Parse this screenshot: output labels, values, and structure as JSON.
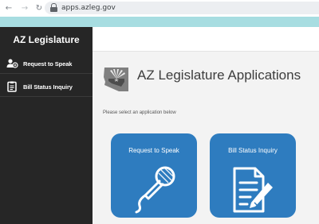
{
  "browser": {
    "back_icon": "arrow-left-icon",
    "forward_icon": "arrow-right-icon",
    "reload_icon": "reload-icon",
    "url": "apps.azleg.gov"
  },
  "sidebar": {
    "brand": "AZ Legislature",
    "items": [
      {
        "label": "Request to Speak",
        "icon": "speaker-user-icon"
      },
      {
        "label": "Bill Status Inquiry",
        "icon": "clipboard-icon"
      }
    ]
  },
  "main": {
    "title": "AZ Legislature Applications",
    "prompt": "Please select an application below",
    "cards": [
      {
        "label": "Request to Speak",
        "icon": "microphone-icon"
      },
      {
        "label": "Bill Status Inquiry",
        "icon": "document-pen-icon"
      }
    ]
  },
  "colors": {
    "sidebar_bg": "#262626",
    "card_blue": "#2e7cbf",
    "header_band": "#a7dde1"
  }
}
